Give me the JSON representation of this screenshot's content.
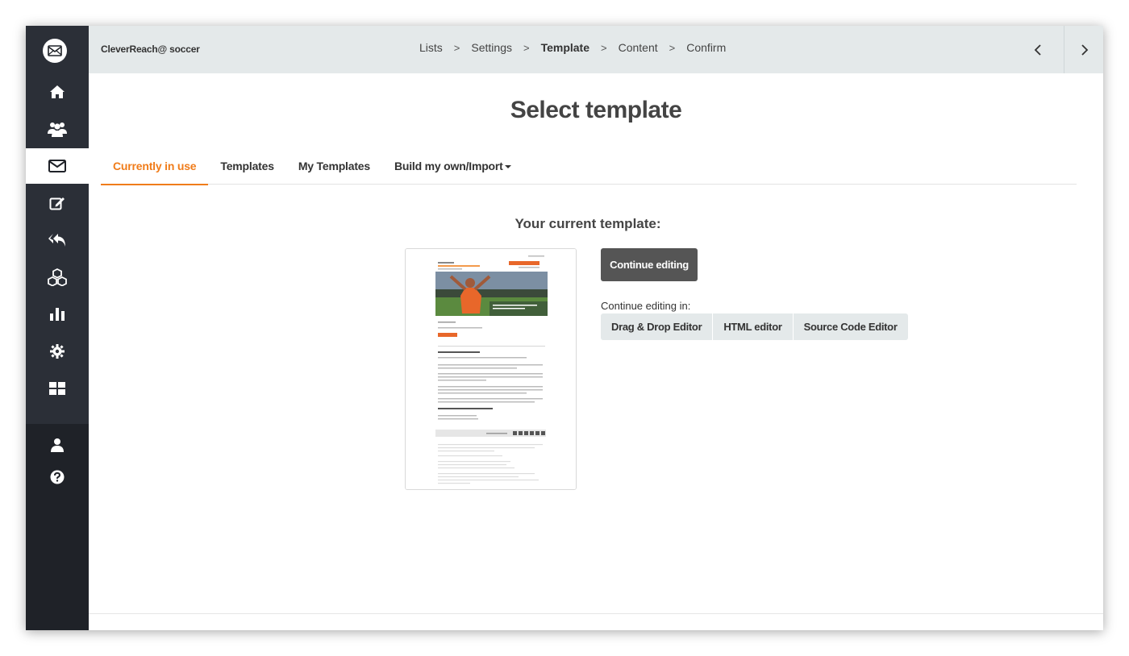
{
  "header": {
    "account": "CleverReach@ soccer",
    "breadcrumbs": [
      {
        "label": "Lists"
      },
      {
        "label": "Settings"
      },
      {
        "label": "Template"
      },
      {
        "label": "Content"
      },
      {
        "label": "Confirm"
      }
    ],
    "active_breadcrumb": "Template",
    "separator": ">"
  },
  "sidebar": {
    "items": [
      "logo-icon",
      "home-icon",
      "contacts-icon",
      "mail-icon",
      "edit-icon",
      "reply-icon",
      "cubes-icon",
      "chart-icon",
      "gear-icon",
      "grid-icon",
      "user-icon",
      "help-icon"
    ],
    "active": "mail-icon"
  },
  "main": {
    "title": "Select template",
    "tabs": [
      {
        "label": "Currently in use"
      },
      {
        "label": "Templates"
      },
      {
        "label": "My Templates"
      },
      {
        "label": "Build my own/Import"
      }
    ],
    "active_tab": "Currently in use",
    "current_heading": "Your current template:",
    "continue_button": "Continue editing",
    "continue_in_label": "Continue editing in:",
    "editors": [
      {
        "label": "Drag & Drop Editor"
      },
      {
        "label": "HTML editor"
      },
      {
        "label": "Source Code Editor"
      }
    ]
  },
  "colors": {
    "accent": "#f07c1a",
    "sidebar": "#2b2f37",
    "header": "#e4e9ea",
    "button_dark": "#555555"
  }
}
